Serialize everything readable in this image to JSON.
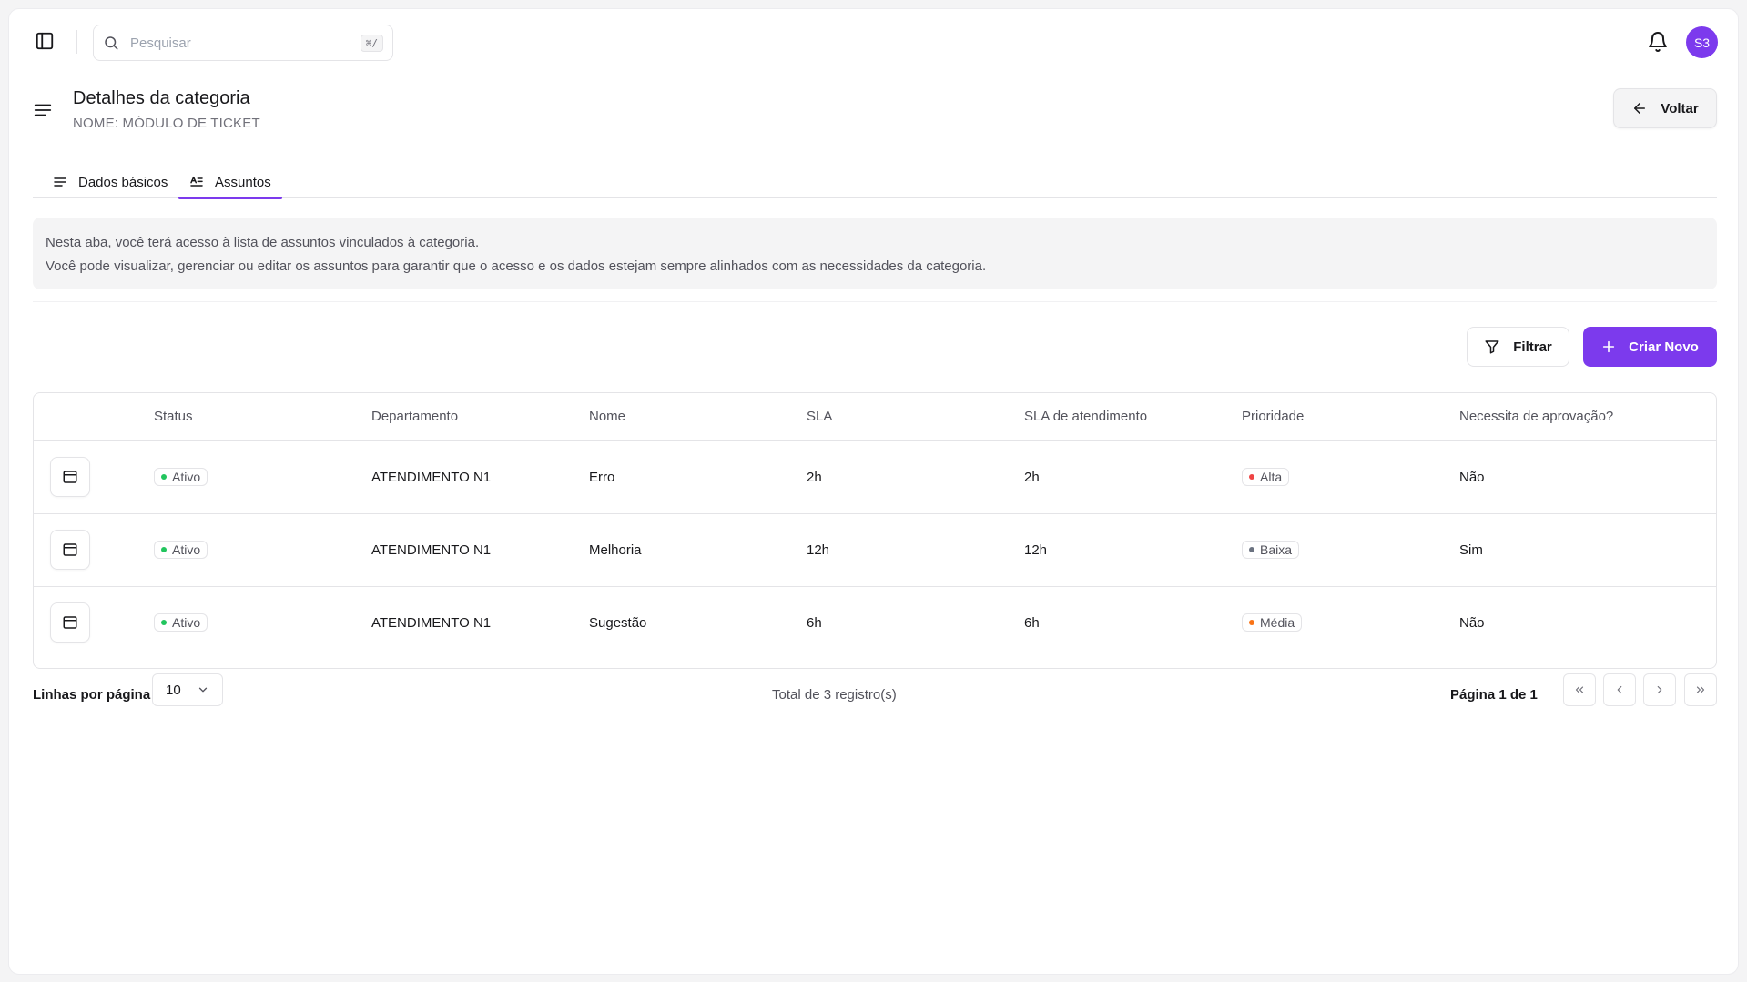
{
  "topbar": {
    "search_placeholder": "Pesquisar",
    "search_shortcut": "⌘/",
    "avatar_initials": "S3"
  },
  "header": {
    "title": "Detalhes da categoria",
    "subtitle": "NOME: MÓDULO DE TICKET",
    "back_label": "Voltar"
  },
  "tabs": [
    {
      "label": "Dados básicos",
      "active": false
    },
    {
      "label": "Assuntos",
      "active": true
    }
  ],
  "info": {
    "line1": "Nesta aba, você terá acesso à lista de assuntos vinculados à categoria.",
    "line2": "Você pode visualizar, gerenciar ou editar os assuntos para garantir que o acesso e os dados estejam sempre alinhados com as necessidades da categoria."
  },
  "actions": {
    "filter_label": "Filtrar",
    "create_label": "Criar Novo"
  },
  "table": {
    "headers": [
      "Status",
      "Departamento",
      "Nome",
      "SLA",
      "SLA de atendimento",
      "Prioridade",
      "Necessita de aprovação?"
    ],
    "rows": [
      {
        "status": "Ativo",
        "departamento": "ATENDIMENTO N1",
        "nome": "Erro",
        "sla": "2h",
        "sla_atendimento": "2h",
        "prioridade": "Alta",
        "aprovacao": "Não"
      },
      {
        "status": "Ativo",
        "departamento": "ATENDIMENTO N1",
        "nome": "Melhoria",
        "sla": "12h",
        "sla_atendimento": "12h",
        "prioridade": "Baixa",
        "aprovacao": "Sim"
      },
      {
        "status": "Ativo",
        "departamento": "ATENDIMENTO N1",
        "nome": "Sugestão",
        "sla": "6h",
        "sla_atendimento": "6h",
        "prioridade": "Média",
        "aprovacao": "Não"
      }
    ]
  },
  "pagination": {
    "rows_label": "Linhas por página",
    "rows_value": "10",
    "total_label": "Total de 3 registro(s)",
    "page_label": "Página 1 de 1"
  },
  "colors": {
    "accent": "#7c3aed",
    "status_active": "#22c55e",
    "priority_high": "#ef4444",
    "priority_low": "#6b7280",
    "priority_medium": "#f97316"
  },
  "icons": [
    "sidebar-toggle-icon",
    "search-icon",
    "bell-icon",
    "menu-icon",
    "arrow-left-icon",
    "list-icon",
    "list-text-icon",
    "filter-icon",
    "plus-icon",
    "calendar-icon",
    "chevron-down-icon",
    "chevrons-left-icon",
    "chevron-left-icon",
    "chevron-right-icon",
    "chevrons-right-icon"
  ]
}
